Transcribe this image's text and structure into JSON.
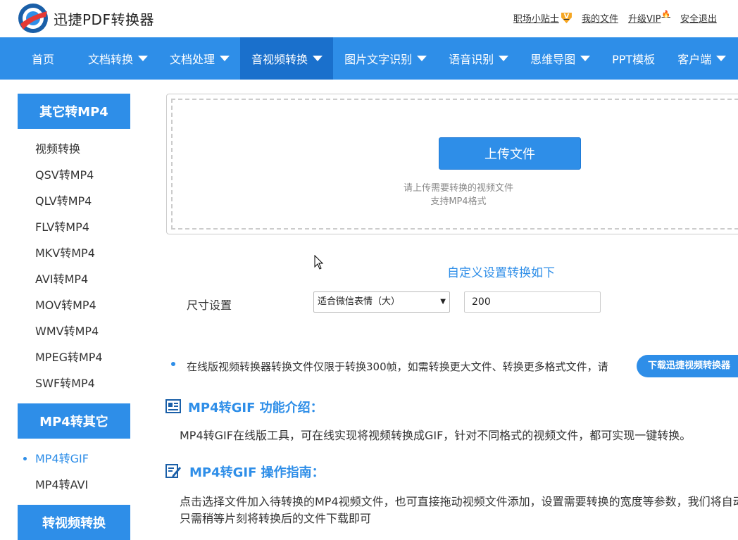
{
  "header": {
    "brand": "迅捷PDF转换器",
    "links": {
      "tips": "职场小贴士",
      "tips_badge": "V",
      "my_files": "我的文件",
      "upgrade": "升级VIP",
      "logout": "安全退出"
    }
  },
  "nav": {
    "items": [
      {
        "label": "首页",
        "has_caret": false
      },
      {
        "label": "文档转换",
        "has_caret": true
      },
      {
        "label": "文档处理",
        "has_caret": true
      },
      {
        "label": "音视频转换",
        "has_caret": true,
        "active": true
      },
      {
        "label": "图片文字识别",
        "has_caret": true
      },
      {
        "label": "语音识别",
        "has_caret": true
      },
      {
        "label": "思维导图",
        "has_caret": true
      },
      {
        "label": "PPT模板",
        "has_caret": false
      },
      {
        "label": "客户端",
        "has_caret": true
      }
    ]
  },
  "sidebar": {
    "group1_title": "其它转MP4",
    "group1_items": [
      "视频转换",
      "QSV转MP4",
      "QLV转MP4",
      "FLV转MP4",
      "MKV转MP4",
      "AVI转MP4",
      "MOV转MP4",
      "WMV转MP4",
      "MPEG转MP4",
      "SWF转MP4"
    ],
    "group2_title": "MP4转其它",
    "group2_items": [
      "MP4转GIF",
      "MP4转AVI"
    ],
    "group2_active": "MP4转GIF",
    "group3_title": "转视频转换"
  },
  "upload": {
    "button_label": "上传文件",
    "hint_line1": "请上传需要转换的视频文件",
    "hint_line2": "支持MP4格式"
  },
  "settings": {
    "title": "自定义设置转换如下",
    "size_label": "尺寸设置",
    "size_select_value": "适合微信表情（大）",
    "size_input_value": "200"
  },
  "notice": {
    "text": "在线版视频转换器转换文件仅限于转换300帧，如需转换更大文件、转换更多格式文件，请",
    "download_button": "下载迅捷视频转换器"
  },
  "intro": {
    "title": "MP4转GIF 功能介绍：",
    "text": "MP4转GIF在线版工具，可在线实现将视频转换成GIF，针对不同格式的视频文件，都可实现一键转换。"
  },
  "guide": {
    "title": "MP4转GIF 操作指南：",
    "text1": "点击选择文件加入待转换的MP4视频文件，也可直接拖动视频文件添加，设置需要转换的宽度等参数，我们将自动",
    "text2": "只需稍等片刻将转换后的文件下载即可"
  },
  "colors": {
    "brand_blue": "#2e8ee8",
    "nav_active": "#1a70cc",
    "badge_gold": "#f5a623"
  }
}
